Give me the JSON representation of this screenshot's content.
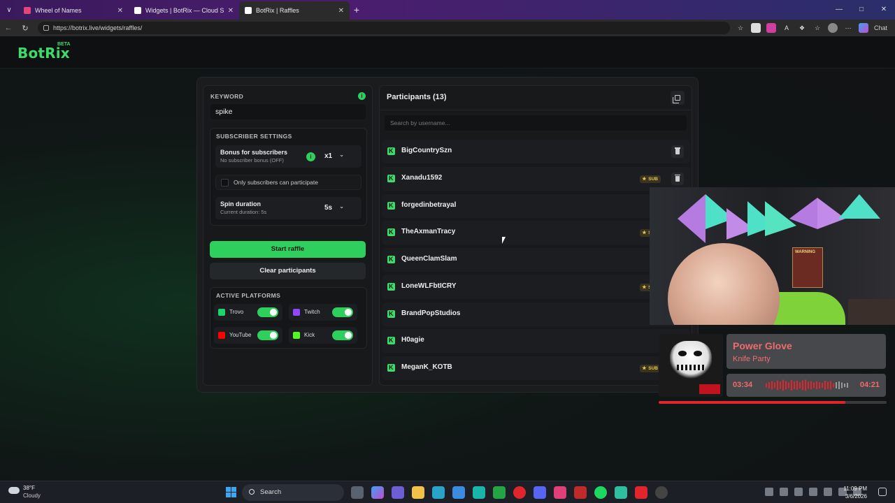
{
  "browser": {
    "tabs": [
      {
        "title": "Wheel of Names",
        "favicon_color": "#e0457b",
        "active": false
      },
      {
        "title": "Widgets | BotRix — Cloud Stream",
        "favicon_color": "#ffffff",
        "active": false
      },
      {
        "title": "BotRix | Raffles",
        "favicon_color": "#ffffff",
        "active": true
      }
    ],
    "url": "https://botrix.live/widgets/raffles/",
    "profile_label": "Chat"
  },
  "brand": {
    "name": "BotRix",
    "badge": "BETA",
    "accent": "#2fcf5d"
  },
  "keyword": {
    "label": "KEYWORD",
    "value": "spike"
  },
  "subscriber_settings": {
    "label": "SUBSCRIBER SETTINGS",
    "bonus": {
      "title": "Bonus for subscribers",
      "subtitle": "No subscriber bonus (OFF)",
      "multiplier": "x1"
    },
    "only_subs": {
      "label": "Only subscribers can participate",
      "checked": false
    },
    "spin": {
      "title": "Spin duration",
      "subtitle": "Current duration: 5s",
      "value": "5s"
    }
  },
  "actions": {
    "start": "Start raffle",
    "clear": "Clear participants"
  },
  "platforms": {
    "label": "ACTIVE PLATFORMS",
    "items": [
      {
        "name": "Trovo",
        "color": "#19d66b",
        "enabled": true
      },
      {
        "name": "Twitch",
        "color": "#9146ff",
        "enabled": true
      },
      {
        "name": "YouTube",
        "color": "#ff0000",
        "enabled": true
      },
      {
        "name": "Kick",
        "color": "#53fc18",
        "enabled": true
      }
    ]
  },
  "participants": {
    "title": "Participants (13)",
    "search_placeholder": "Search by username...",
    "list": [
      {
        "name": "BigCountrySzn",
        "sub": false
      },
      {
        "name": "Xanadu1592",
        "sub": true
      },
      {
        "name": "forgedinbetrayal",
        "sub": false
      },
      {
        "name": "TheAxmanTracy",
        "sub": true
      },
      {
        "name": "QueenClamSlam",
        "sub": false
      },
      {
        "name": "LoneWLFbtICRY",
        "sub": true
      },
      {
        "name": "BrandPopStudios",
        "sub": false
      },
      {
        "name": "H0agie",
        "sub": false
      },
      {
        "name": "MeganK_KOTB",
        "sub": true
      }
    ],
    "sub_badge": "SUB"
  },
  "stream_overlay": {
    "poster_text": "WARNING",
    "song": {
      "title": "Power Glove",
      "artist": "Knife Party",
      "current": "03:34",
      "total": "04:21",
      "progress": 0.82
    }
  },
  "taskbar": {
    "weather": {
      "temp": "38°F",
      "condition": "Cloudy"
    },
    "search": "Search",
    "time": "11:09 PM",
    "date": "3/6/2026"
  }
}
